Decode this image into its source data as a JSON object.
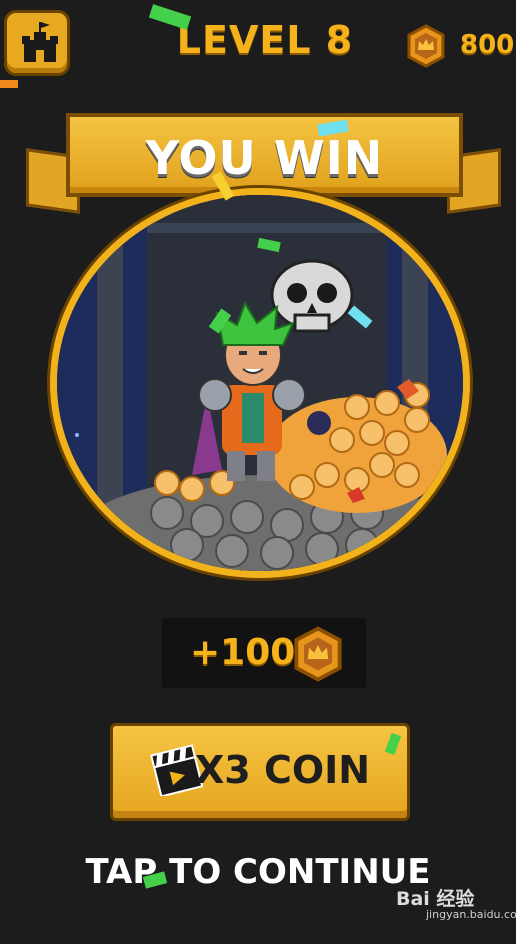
{
  "header": {
    "home_icon": "castle-icon",
    "level_label": "LEVEL 8",
    "coin_total": "800",
    "coin_icon": "crown-coin-icon"
  },
  "banner": {
    "title": "YOU WIN"
  },
  "scene": {
    "character": "green-haired-hero",
    "enemy_icon": "skull-icon",
    "treasure": "coin-pile"
  },
  "reward": {
    "amount": "+100",
    "coin_icon": "crown-coin-icon"
  },
  "actions": {
    "multiply_label": "X3 COIN",
    "multiply_icon": "clapperboard-icon",
    "continue_label": "TAP TO CONTINUE"
  },
  "watermark": {
    "brand": "Bai 经验",
    "url": "jingyan.baidu.com"
  },
  "colors": {
    "gold": "#f6b21a",
    "background": "#1c1c1c",
    "button": "#e9aa22"
  }
}
